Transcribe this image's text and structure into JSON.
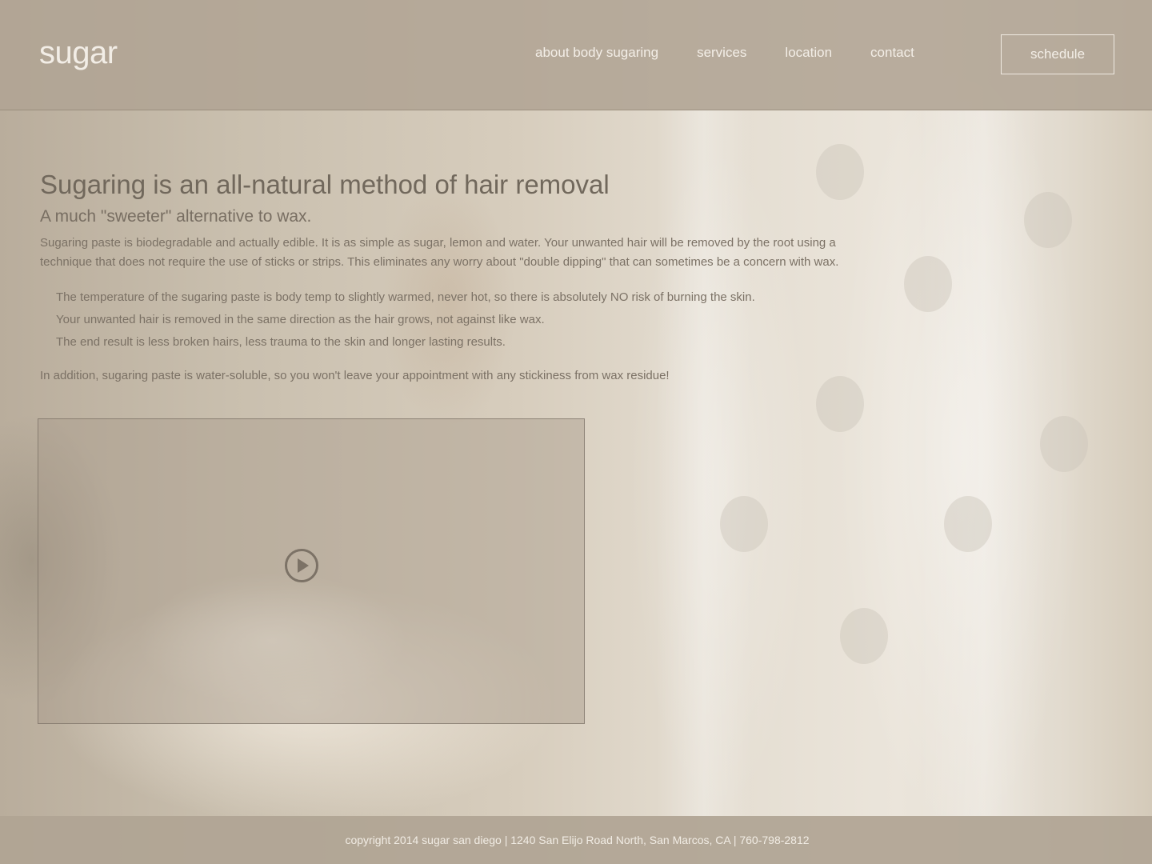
{
  "header": {
    "logo": "sugar",
    "nav": [
      {
        "label": "about body sugaring"
      },
      {
        "label": "services"
      },
      {
        "label": "location"
      },
      {
        "label": "contact"
      }
    ],
    "schedule_label": "schedule"
  },
  "main": {
    "headline": "Sugaring is an all-natural method of hair removal",
    "subhead": "A much \"sweeter\" alternative to wax.",
    "intro": "Sugaring paste is biodegradable and actually edible.  It is as simple as sugar, lemon and water. Your unwanted hair will be removed by the root using a technique that does not require the use of sticks or strips. This eliminates any worry about \"double dipping\" that can sometimes be a concern with wax.",
    "bullets": [
      "The temperature of the sugaring paste is body temp to slightly warmed, never hot, so there is absolutely NO risk of burning the skin.",
      "Your unwanted hair is removed in the same direction as the hair grows, not against like wax.",
      "The end result is less broken hairs, less trauma to the skin and longer lasting results."
    ],
    "addition": "In addition, sugaring  paste is water-soluble, so you won't leave your appointment with any stickiness from wax residue!",
    "video": {
      "play_icon": "play-circle-icon"
    }
  },
  "footer": {
    "text": "copyright 2014 sugar san diego | 1240 San Elijo Road North, San Marcos, CA | 760-798-2812"
  }
}
